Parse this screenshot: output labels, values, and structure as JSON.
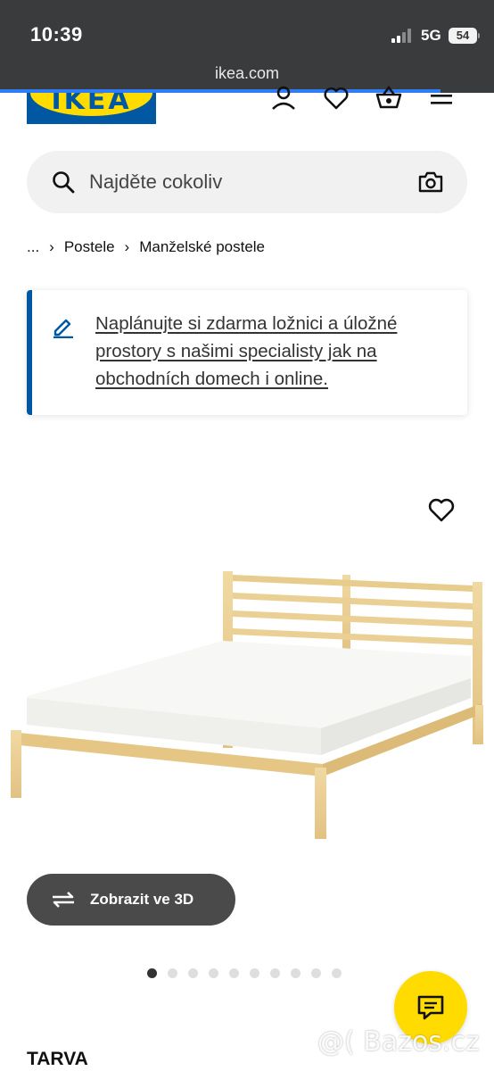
{
  "status_bar": {
    "time": "10:39",
    "network": "5G",
    "battery": "54"
  },
  "browser": {
    "url": "ikea.com"
  },
  "header": {
    "logo_text": "IKEA"
  },
  "search": {
    "placeholder": "Najděte cokoliv"
  },
  "breadcrumb": {
    "items": [
      "...",
      "Postele",
      "Manželské postele"
    ]
  },
  "banner": {
    "text": "Naplánujte si zdarma ložnici a úložné prostory s našimi specialisty jak na obchodních domech i online."
  },
  "gallery": {
    "view_3d_label": "Zobrazit ve 3D",
    "dot_count": 10,
    "active_index": 0
  },
  "product": {
    "name": "TARVA"
  },
  "watermark": "@( Bazos.cz",
  "colors": {
    "brand_blue": "#0058a3",
    "brand_yellow": "#ffdb00",
    "status_bar_bg": "#3a3b3d",
    "link_progress": "#2e7df6"
  },
  "icons": [
    "search-icon",
    "camera-icon",
    "user-icon",
    "heart-icon",
    "basket-icon",
    "menu-icon",
    "pencil-icon",
    "rotate-3d-icon",
    "chat-icon"
  ]
}
